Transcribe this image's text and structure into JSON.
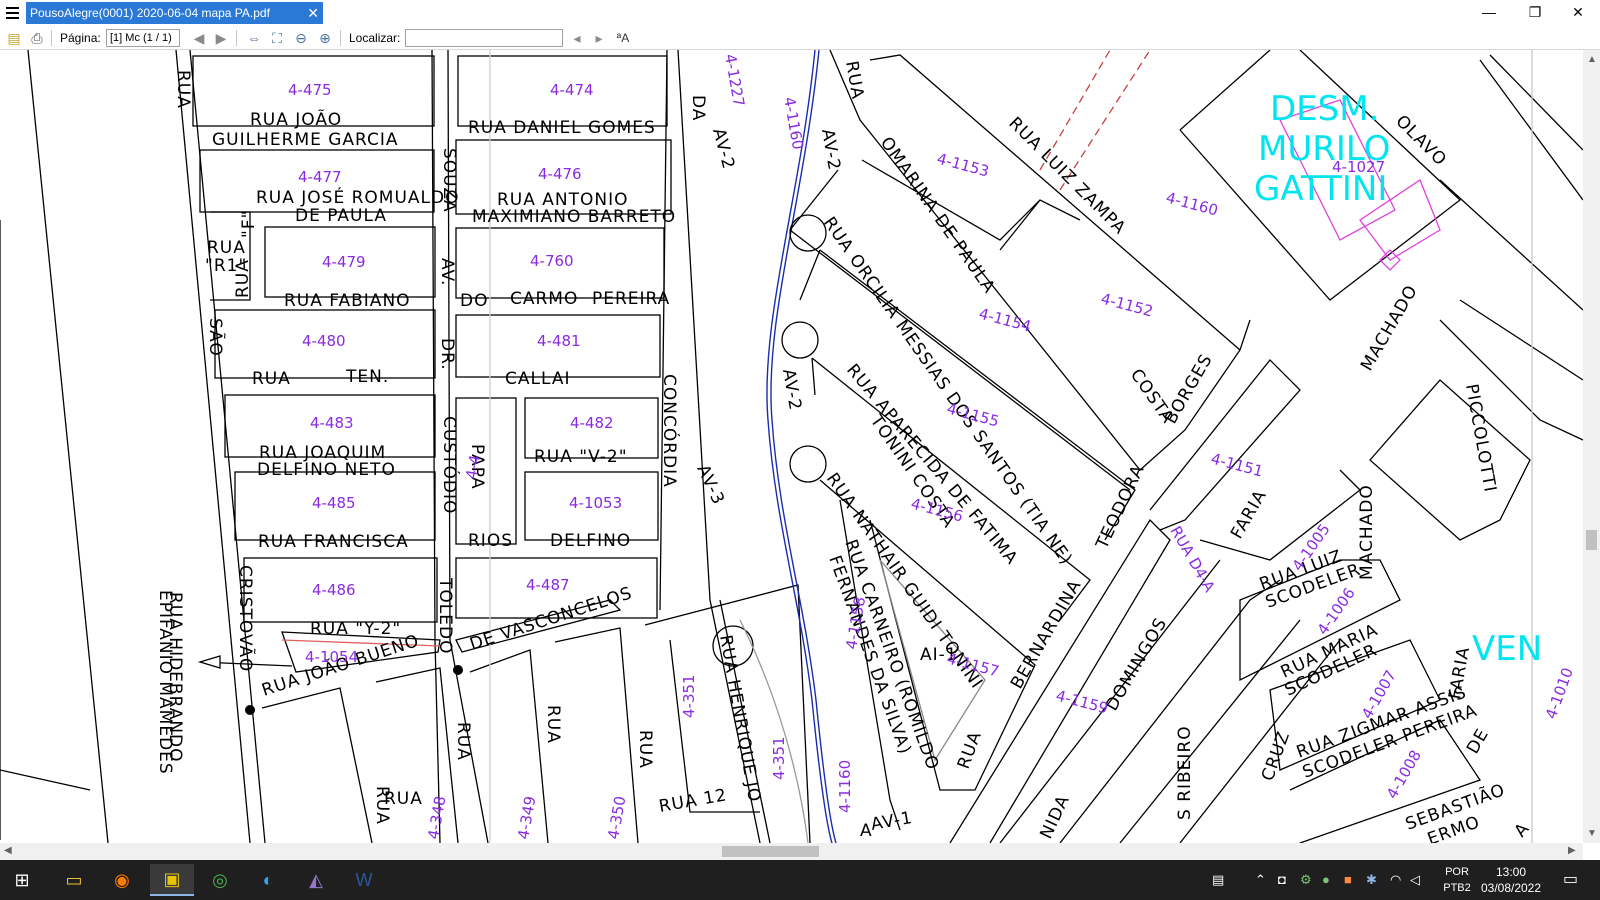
{
  "titlebar": {
    "tab_title": "PousoAlegre(0001) 2020-06-04 mapa PA.pdf",
    "tab_close": "✕",
    "minimize": "—",
    "maximize": "❐",
    "close": "✕"
  },
  "toolbar": {
    "page_label": "Página:",
    "page_value": "[1] Mc (1 / 1)",
    "search_label": "Localizar:",
    "search_value": ""
  },
  "map": {
    "streets": [
      "RUA",
      "RUA JOÃO",
      "GUILHERME GARCIA",
      "RUA DANIEL GOMES",
      "DA",
      "AV-2",
      "4-1227",
      "4-1160",
      "RUA",
      "AV-2",
      "OMARINA DE PAULA",
      "RUA LUIZ ZAMPA",
      "DESM.",
      "MURILO",
      "GATTINI",
      "OLAVO",
      "RUA JOSÉ ROMUALDO",
      "DE PAULA",
      "SOUZA",
      "RUA ANTONIO",
      "MAXIMIANO BARRETO",
      "RUA",
      "\"R1\"",
      "RUA",
      "\"F\"",
      "RUA FABIANO",
      "AV.",
      "DO",
      "CARMO",
      "PEREIRA",
      "SÃO",
      "DR.",
      "RUA",
      "TEN.",
      "CALLAI",
      "CONCÓRDIA",
      "RUA ORCILIA MESSIAS DOS SANTOS (TIA NE)",
      "COSTA",
      "BORGES",
      "MACHADO",
      "PICCOLOTTI",
      "RUA JOAQUIM",
      "DELFINO NETO",
      "CUSTÓDIO",
      "PAPA",
      "RUA \"V-2\"",
      "AV-3",
      "RUA APARECIDA DE FATIMA",
      "TONINI COSTA",
      "AV-2",
      "TEODORA",
      "RUA D4-A",
      "FARIA",
      "RUA FRANCISCA",
      "RIOS",
      "DELFINO",
      "TOLEDO",
      "CRISTOVÃO",
      "RUA HIDEBRANDO",
      "EPIFANIO MAMEDES",
      "RUA \"Y-2\"",
      "DE VASCONCELOS",
      "RUA NATHAIR GUIDI TONINI",
      "RUA CARNEIRO (ROMILDO",
      "FERNANDES DA SILVA)",
      "BERNARDINA",
      "DOMINGOS",
      "RUA LUIZ",
      "SCODELER",
      "RUA MARIA",
      "SCODELER",
      "MACHADO",
      "VEN",
      "RUA JOÃO BUENO",
      "RUA",
      "RUA",
      "RUA",
      "RUA HENRIQUE JO",
      "AI-1",
      "RUA",
      "NIDA",
      "S RIBEIRO",
      "CRUZ",
      "RUA ZIGMAR ASSIS",
      "SCODELER PEREIRA",
      "DE",
      "FARIA",
      "RUA",
      "RUA",
      "RUA 12",
      "AV-1",
      "A",
      "SEBASTIÃO",
      "ERMO",
      "A"
    ],
    "lots": [
      "4-475",
      "4-474",
      "4-477",
      "4-476",
      "4-1153",
      "4-1160",
      "4-1027",
      "4-479",
      "4-760",
      "4-1154",
      "4-1152",
      "4-480",
      "4-481",
      "4-1155",
      "4-483",
      "4-482",
      "4-1151",
      "4-4",
      "4-485",
      "4-1053",
      "4-1156",
      "4-1005",
      "4-486",
      "4-487",
      "4-1006",
      "4-1054",
      "4-1157",
      "4-1158",
      "4-1159",
      "4-351",
      "4-351",
      "4-1007",
      "4-1160",
      "4-1008",
      "4-348",
      "4-349",
      "4-350",
      "4-1010"
    ]
  },
  "taskbar": {
    "lang_line1": "POR",
    "lang_line2": "PTB2",
    "time": "13:00",
    "date": "03/08/2022"
  }
}
